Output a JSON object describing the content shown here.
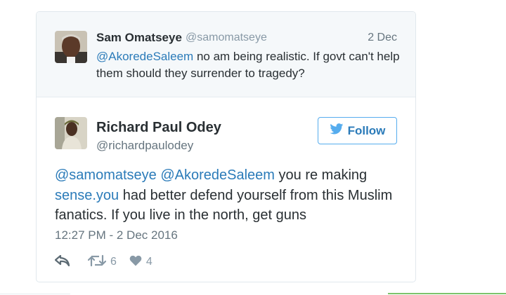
{
  "parent_tweet": {
    "author_name": "Sam Omatseye",
    "author_handle": "@samomatseye",
    "date": "2 Dec",
    "mention": "@AkoredeSaleem",
    "text": " no am being realistic. If govt can't help them should they surrender to tragedy?"
  },
  "main_tweet": {
    "author_name": "Richard Paul Odey",
    "author_handle": "@richardpaulodey",
    "follow_label": "Follow",
    "mention_1": "@samomatseye",
    "mention_2": "@AkoredeSaleem",
    "text_1": " you re making ",
    "link": "sense.you",
    "text_2": " had better defend yourself from this Muslim fanatics. If you live in the north, get guns",
    "timestamp": "12:27 PM - 2 Dec 2016",
    "retweet_count": "6",
    "like_count": "4"
  },
  "icons": {
    "reply": "reply-icon",
    "retweet": "retweet-icon",
    "like": "heart-icon",
    "twitter": "twitter-bird-icon"
  },
  "colors": {
    "link": "#2b7bb9",
    "action_gray": "#8899a6",
    "follow_border": "#55acee",
    "parent_bg": "#f5f8fa"
  }
}
